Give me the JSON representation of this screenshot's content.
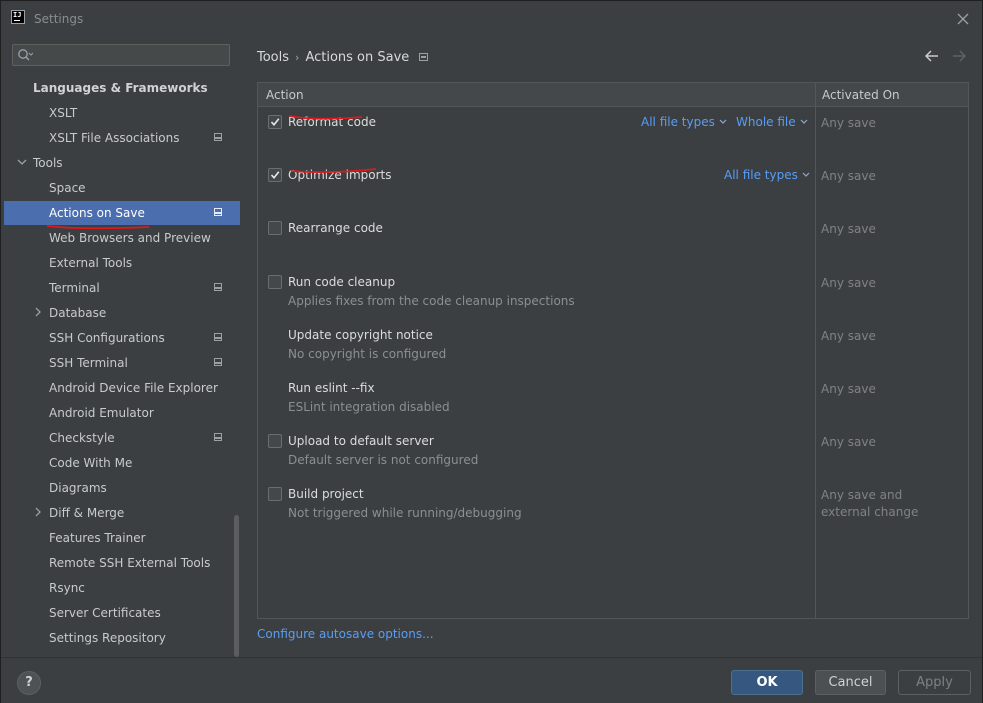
{
  "window": {
    "title": "Settings",
    "app_icon_text": "IJ"
  },
  "icons": {
    "app": "intellij-icon",
    "close": "close-icon",
    "search": "search-icon",
    "back": "arrow-left-icon",
    "forward": "arrow-right-icon",
    "help": "help-icon"
  },
  "sidebar": {
    "search_placeholder": "",
    "items": [
      {
        "label": "Languages & Frameworks",
        "level": 0,
        "bold": true,
        "expander": "none",
        "project_icon": false,
        "selected": false
      },
      {
        "label": "XSLT",
        "level": 1,
        "bold": false,
        "expander": "none",
        "project_icon": false,
        "selected": false
      },
      {
        "label": "XSLT File Associations",
        "level": 1,
        "bold": false,
        "expander": "none",
        "project_icon": true,
        "selected": false
      },
      {
        "label": "Tools",
        "level": 0,
        "bold": false,
        "expander": "expanded",
        "project_icon": false,
        "selected": false
      },
      {
        "label": "Space",
        "level": 1,
        "bold": false,
        "expander": "none",
        "project_icon": false,
        "selected": false
      },
      {
        "label": "Actions on Save",
        "level": 1,
        "bold": false,
        "expander": "none",
        "project_icon": true,
        "selected": true
      },
      {
        "label": "Web Browsers and Preview",
        "level": 1,
        "bold": false,
        "expander": "none",
        "project_icon": false,
        "selected": false
      },
      {
        "label": "External Tools",
        "level": 1,
        "bold": false,
        "expander": "none",
        "project_icon": false,
        "selected": false
      },
      {
        "label": "Terminal",
        "level": 1,
        "bold": false,
        "expander": "none",
        "project_icon": true,
        "selected": false
      },
      {
        "label": "Database",
        "level": 1,
        "bold": false,
        "expander": "collapsed",
        "project_icon": false,
        "selected": false
      },
      {
        "label": "SSH Configurations",
        "level": 1,
        "bold": false,
        "expander": "none",
        "project_icon": true,
        "selected": false
      },
      {
        "label": "SSH Terminal",
        "level": 1,
        "bold": false,
        "expander": "none",
        "project_icon": true,
        "selected": false
      },
      {
        "label": "Android Device File Explorer",
        "level": 1,
        "bold": false,
        "expander": "none",
        "project_icon": false,
        "selected": false
      },
      {
        "label": "Android Emulator",
        "level": 1,
        "bold": false,
        "expander": "none",
        "project_icon": false,
        "selected": false
      },
      {
        "label": "Checkstyle",
        "level": 1,
        "bold": false,
        "expander": "none",
        "project_icon": true,
        "selected": false
      },
      {
        "label": "Code With Me",
        "level": 1,
        "bold": false,
        "expander": "none",
        "project_icon": false,
        "selected": false
      },
      {
        "label": "Diagrams",
        "level": 1,
        "bold": false,
        "expander": "none",
        "project_icon": false,
        "selected": false
      },
      {
        "label": "Diff & Merge",
        "level": 1,
        "bold": false,
        "expander": "collapsed",
        "project_icon": false,
        "selected": false
      },
      {
        "label": "Features Trainer",
        "level": 1,
        "bold": false,
        "expander": "none",
        "project_icon": false,
        "selected": false
      },
      {
        "label": "Remote SSH External Tools",
        "level": 1,
        "bold": false,
        "expander": "none",
        "project_icon": false,
        "selected": false
      },
      {
        "label": "Rsync",
        "level": 1,
        "bold": false,
        "expander": "none",
        "project_icon": false,
        "selected": false
      },
      {
        "label": "Server Certificates",
        "level": 1,
        "bold": false,
        "expander": "none",
        "project_icon": false,
        "selected": false
      },
      {
        "label": "Settings Repository",
        "level": 1,
        "bold": false,
        "expander": "none",
        "project_icon": false,
        "selected": false
      }
    ]
  },
  "breadcrumb": {
    "parent": "Tools",
    "separator": "›",
    "current": "Actions on Save"
  },
  "table": {
    "headers": {
      "action": "Action",
      "activated_on": "Activated On"
    },
    "rows": [
      {
        "title": "Reformat code",
        "subtitle": "",
        "has_checkbox": true,
        "checked": true,
        "activated_on": "Any save",
        "options": [
          "All file types",
          "Whole file"
        ]
      },
      {
        "title": "Optimize imports",
        "subtitle": "",
        "has_checkbox": true,
        "checked": true,
        "activated_on": "Any save",
        "options": [
          "All file types"
        ]
      },
      {
        "title": "Rearrange code",
        "subtitle": "",
        "has_checkbox": true,
        "checked": false,
        "activated_on": "Any save",
        "options": []
      },
      {
        "title": "Run code cleanup",
        "subtitle": "Applies fixes from the code cleanup inspections",
        "has_checkbox": true,
        "checked": false,
        "activated_on": "Any save",
        "options": []
      },
      {
        "title": "Update copyright notice",
        "subtitle": "No copyright is configured",
        "has_checkbox": false,
        "checked": false,
        "activated_on": "Any save",
        "options": []
      },
      {
        "title": "Run eslint --fix",
        "subtitle": "ESLint integration disabled",
        "has_checkbox": false,
        "checked": false,
        "activated_on": "Any save",
        "options": []
      },
      {
        "title": "Upload to default server",
        "subtitle": "Default server is not configured",
        "has_checkbox": true,
        "checked": false,
        "activated_on": "Any save",
        "options": []
      },
      {
        "title": "Build project",
        "subtitle": "Not triggered while running/debugging",
        "has_checkbox": true,
        "checked": false,
        "activated_on": "Any save and\nexternal change",
        "options": []
      }
    ]
  },
  "configure_link": "Configure autosave options...",
  "footer": {
    "help": "?",
    "ok": "OK",
    "cancel": "Cancel",
    "apply": "Apply"
  },
  "colors": {
    "selection": "#4b6eaf",
    "link": "#589df6",
    "annotation": "#e0181c",
    "ok_button": "#365880"
  }
}
